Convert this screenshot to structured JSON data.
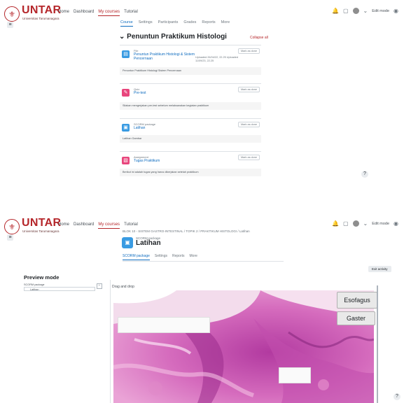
{
  "brand": {
    "name": "UNTAR",
    "sub": "Universitas Tarumanagara"
  },
  "nav": [
    "Home",
    "Dashboard",
    "My courses",
    "Tutorial"
  ],
  "nav2": [
    "Home",
    "Dashboard",
    "My courses",
    "Tutorial"
  ],
  "user": {
    "name": "Edit mode"
  },
  "course_tabs": [
    "Course",
    "Settings",
    "Participants",
    "Grades",
    "Reports",
    "More"
  ],
  "section": {
    "title": "Penuntun Praktikum Histologi",
    "collapse": "Collapse all"
  },
  "activities": [
    {
      "type": "File",
      "name": "Penuntun Praktikum Histologi & Sistem Pencernaan",
      "extra": "Uploaded 26/04/22, 22.25 Uploaded 11/09/23, 22.25",
      "mark": "Mark as done",
      "desc": "Penuntun Praktikum Histologi Sistem Pencernaan",
      "color": "#399be2",
      "icon": "▤"
    },
    {
      "type": "Quiz",
      "name": "Pre-test",
      "extra": "",
      "mark": "Mark as done",
      "desc": "Silakan mengerjakan pre-test sebelum melaksanakan kegiatan praktikum",
      "color": "#e8457c",
      "icon": "✎"
    },
    {
      "type": "SCORM package",
      "name": "Latihan",
      "extra": "",
      "mark": "Mark as done",
      "desc": "Latihan Gambar",
      "color": "#399be2",
      "icon": "▣"
    },
    {
      "type": "Assignment",
      "name": "Tugas Praktikum",
      "extra": "",
      "mark": "Mark as done",
      "desc": "Berikut ini adalah tugas yang harus dikerjakan setelah praktikum",
      "color": "#e8457c",
      "icon": "▧"
    }
  ],
  "breadcrumb": "BLOK 10 - SISTEM GASTRO-INTESTINAL / TOPIK 2 / PRAKTIKUM HISTOLOGI / Latihan",
  "scorm": {
    "type": "SCORM package",
    "title": "Latihan",
    "exit": "Exit activity"
  },
  "scorm_tabs": [
    "SCORM package",
    "Settings",
    "Reports",
    "More"
  ],
  "preview": {
    "title": "Preview mode",
    "toc_head": "SCORM package",
    "toc_item": "Latihan",
    "toc_close": "−"
  },
  "question": {
    "label": "Drag and drop",
    "answers": [
      "Esofagus",
      "Gaster"
    ]
  },
  "colors": {
    "brand": "#b5262a",
    "link": "#0f6cbf"
  }
}
